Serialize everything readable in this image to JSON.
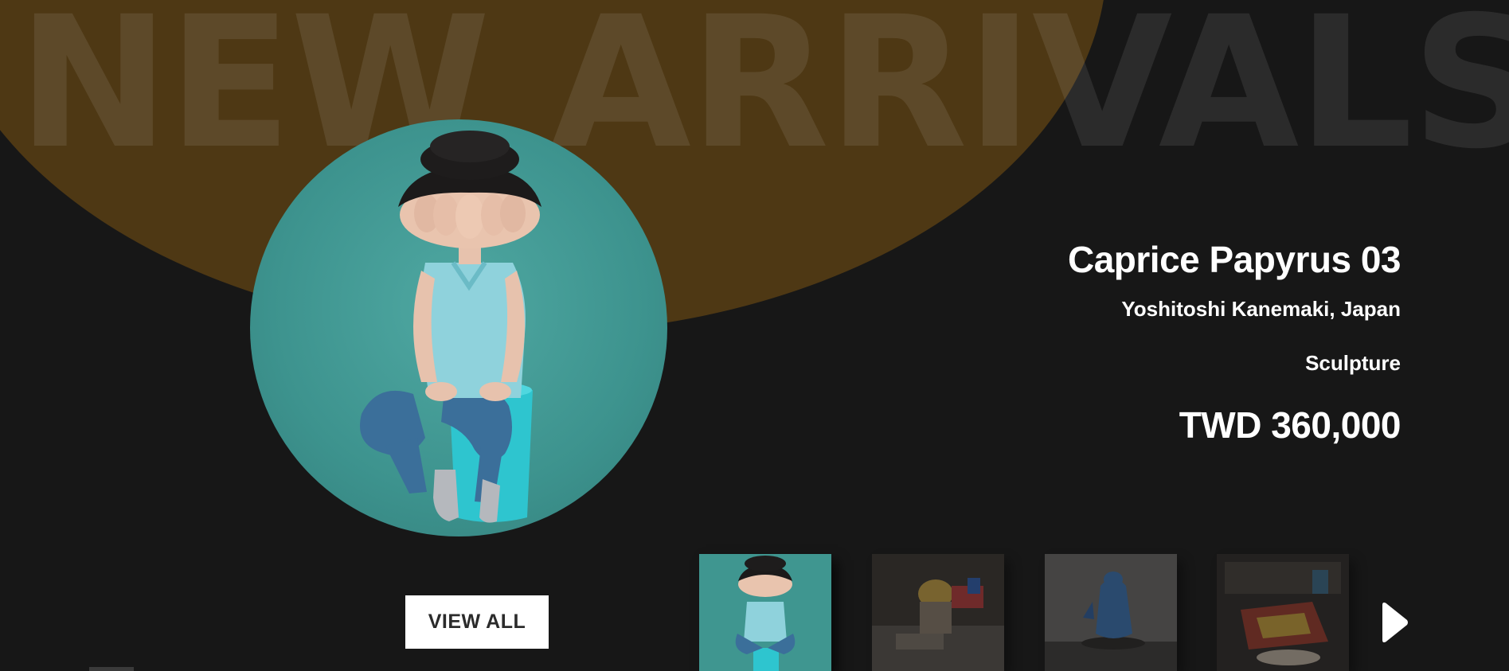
{
  "hero": {
    "title": "NEW ARRIVALS"
  },
  "featured": {
    "title": "Caprice Papyrus 03",
    "artist": "Yoshitoshi Kanemaki, Japan",
    "category": "Sculpture",
    "price": "TWD 360,000"
  },
  "actions": {
    "view_all_label": "VIEW ALL"
  },
  "thumbnails": [
    {
      "selected": true
    },
    {
      "selected": false
    },
    {
      "selected": false
    },
    {
      "selected": false
    }
  ],
  "icons": {
    "next": "chevron-right-icon"
  },
  "colors": {
    "background": "#171717",
    "accent_blob": "#4e3814",
    "feature_bg": "#3d938e",
    "button_bg": "#ffffff"
  }
}
